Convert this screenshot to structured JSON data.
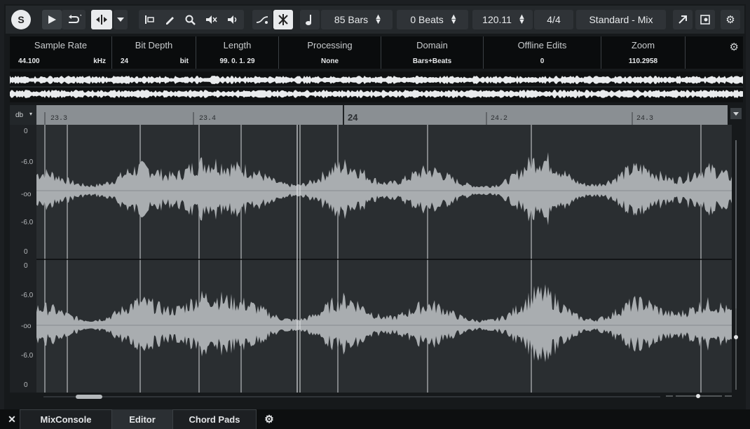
{
  "toolbar": {
    "solo_label": "S",
    "bars_value": "85 Bars",
    "beats_value": "0 Beats",
    "tempo_value": "120.11",
    "signature_value": "4/4",
    "preset_value": "Standard - Mix"
  },
  "infobar": {
    "columns": [
      {
        "header": "Sample Rate",
        "value": "44.100",
        "unit": "kHz"
      },
      {
        "header": "Bit Depth",
        "value": "24",
        "unit": "bit"
      },
      {
        "header": "Length",
        "value": "99. 0. 1. 29"
      },
      {
        "header": "Processing",
        "value": "None"
      },
      {
        "header": "Domain",
        "value": "Bars+Beats"
      },
      {
        "header": "Offline Edits",
        "value": "0"
      },
      {
        "header": "Zoom",
        "value": "110.2958"
      }
    ]
  },
  "ruler": {
    "db_label": "db",
    "ticks": [
      "23.3",
      "23.4",
      "24",
      "24.2",
      "24.3"
    ]
  },
  "db_scale": {
    "top_channel": [
      "0",
      "-6.0",
      "-oo",
      "-6.0",
      "0"
    ],
    "bottom_channel": [
      "0",
      "-6.0",
      "-oo",
      "-6.0",
      "0"
    ]
  },
  "tabs": {
    "close_label": "✕",
    "items": [
      "MixConsole",
      "Editor",
      "Chord Pads"
    ],
    "active": "Editor"
  },
  "icons": [
    "solo-icon",
    "play-icon",
    "loop-icon",
    "snap-icon",
    "range-select-icon",
    "pencil-icon",
    "zoom-icon",
    "mute-icon",
    "speaker-icon",
    "curve-icon",
    "hitpoints-icon",
    "metronome-icon",
    "export-icon",
    "settings-icon",
    "gear-icon"
  ],
  "colors": {
    "accent": "#e9ebed",
    "waveform": "#a9adb0",
    "background": "#2a2e31",
    "ruler": "#8a8f93"
  }
}
